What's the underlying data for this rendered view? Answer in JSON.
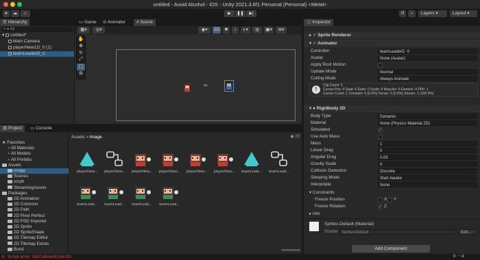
{
  "window": {
    "title": "untitled - Avoid Alcohol - iOS - Unity 2021.3.6f1 Personal (Personal) <Metal>"
  },
  "toolbar": {
    "account_label": "",
    "layers_label": "Layers",
    "layout_label": "Layout"
  },
  "scene_tabs": [
    {
      "label": "Game"
    },
    {
      "label": "Animator"
    },
    {
      "label": "Scene"
    }
  ],
  "scene_toolbar": {
    "mode_2d": "2D"
  },
  "hierarchy": {
    "tab": "Hierarchy",
    "search_placeholder": "All",
    "scene": "untitled*",
    "items": [
      {
        "label": "Main Camera"
      },
      {
        "label": "playerNew1D_0 (1)"
      },
      {
        "label": "teamLeaderD_0"
      }
    ]
  },
  "project": {
    "tabs": [
      {
        "label": "Project"
      },
      {
        "label": "Console"
      }
    ],
    "breadcrumb_root": "Assets",
    "breadcrumb_sep": ">",
    "breadcrumb_leaf": "image",
    "item_count": "23",
    "tree": [
      {
        "label": "Favorites",
        "indent": 0,
        "folder": false,
        "selected": false
      },
      {
        "label": "All Materials",
        "indent": 1,
        "folder": false,
        "selected": false
      },
      {
        "label": "All Models",
        "indent": 1,
        "folder": false,
        "selected": false
      },
      {
        "label": "All Prefabs",
        "indent": 1,
        "folder": false,
        "selected": false
      },
      {
        "label": "Assets",
        "indent": 0,
        "folder": true,
        "selected": false
      },
      {
        "label": "image",
        "indent": 1,
        "folder": true,
        "selected": true
      },
      {
        "label": "Scenes",
        "indent": 1,
        "folder": true,
        "selected": false
      },
      {
        "label": "scrpit",
        "indent": 1,
        "folder": true,
        "selected": false
      },
      {
        "label": "StreamingAssets",
        "indent": 1,
        "folder": true,
        "selected": false
      },
      {
        "label": "Packages",
        "indent": 0,
        "folder": true,
        "selected": false
      },
      {
        "label": "2D Animation",
        "indent": 1,
        "folder": true,
        "selected": false
      },
      {
        "label": "2D Common",
        "indent": 1,
        "folder": true,
        "selected": false
      },
      {
        "label": "2D Path",
        "indent": 1,
        "folder": true,
        "selected": false
      },
      {
        "label": "2D Pixel Perfect",
        "indent": 1,
        "folder": true,
        "selected": false
      },
      {
        "label": "2D PSD Importer",
        "indent": 1,
        "folder": true,
        "selected": false
      },
      {
        "label": "2D Sprite",
        "indent": 1,
        "folder": true,
        "selected": false
      },
      {
        "label": "2D SpriteShape",
        "indent": 1,
        "folder": true,
        "selected": false
      },
      {
        "label": "2D Tilemap Editor",
        "indent": 1,
        "folder": true,
        "selected": false
      },
      {
        "label": "2D Tilemap Extras",
        "indent": 1,
        "folder": true,
        "selected": false
      },
      {
        "label": "Burst",
        "indent": 1,
        "folder": true,
        "selected": false
      }
    ],
    "assets": [
      {
        "label": "playerNew...",
        "kind": "triangle"
      },
      {
        "label": "playerNew...",
        "kind": "controller"
      },
      {
        "label": "playerNew...",
        "kind": "sprite"
      },
      {
        "label": "playerNew...",
        "kind": "sprite"
      },
      {
        "label": "playerNew...",
        "kind": "sprite"
      },
      {
        "label": "playerNew...",
        "kind": "sprite"
      },
      {
        "label": "teamLead...",
        "kind": "triangle"
      },
      {
        "label": "teamLead...",
        "kind": "controller"
      },
      {
        "label": "teamLead...",
        "kind": "sprite-dark"
      },
      {
        "label": "teamLead...",
        "kind": "sprite-dark"
      },
      {
        "label": "teamLead...",
        "kind": "sprite-dark"
      },
      {
        "label": "teamLead...",
        "kind": "sprite-dark"
      }
    ]
  },
  "inspector": {
    "tab": "Inspector",
    "sprite_renderer": "Sprite Renderer",
    "animator": {
      "header": "Animator",
      "rows": [
        {
          "label": "Controller",
          "value": "teamLeaderD_0",
          "type": "field"
        },
        {
          "label": "Avatar",
          "value": "None (Avatar)",
          "type": "field"
        },
        {
          "label": "Apply Root Motion",
          "value": "",
          "type": "check"
        },
        {
          "label": "Update Mode",
          "value": "Normal",
          "type": "field"
        },
        {
          "label": "Culling Mode",
          "value": "Always Animate",
          "type": "field"
        }
      ],
      "info": [
        "Clip Count: 1",
        "Curves Pos: 0 Quat: 0 Euler: 0 Scale: 0 Muscles: 0 Generic: 0 PPtr: 1",
        "Curves Count: 1 Constant: 0 (0.0%) Dense: 0 (0.0%) Stream: 1 (100.0%)"
      ]
    },
    "rigidbody": {
      "header": "Rigidbody 2D",
      "rows": [
        {
          "label": "Body Type",
          "value": "Dynamic",
          "type": "field"
        },
        {
          "label": "Material",
          "value": "None (Physics Material 2D)",
          "type": "field"
        },
        {
          "label": "Simulated",
          "value": "✓",
          "type": "check"
        },
        {
          "label": "Use Auto Mass",
          "value": "",
          "type": "check"
        },
        {
          "label": "Mass",
          "value": "1",
          "type": "field"
        },
        {
          "label": "Linear Drag",
          "value": "0",
          "type": "field"
        },
        {
          "label": "Angular Drag",
          "value": "0.05",
          "type": "field"
        },
        {
          "label": "Gravity Scale",
          "value": "0",
          "type": "field"
        },
        {
          "label": "Collision Detection",
          "value": "Discrete",
          "type": "field"
        },
        {
          "label": "Sleeping Mode",
          "value": "Start Awake",
          "type": "field"
        },
        {
          "label": "Interpolate",
          "value": "None",
          "type": "field"
        }
      ],
      "constraints": "Constraints",
      "freeze_position": "Freeze Position",
      "fp_x": "X",
      "fp_y": "Y",
      "freeze_rotation": "Freeze Rotation",
      "fr_z": "Z",
      "info": "Info"
    },
    "material_name": "Sprites-Default (Material)",
    "shader_label": "Shader",
    "shader_value": "Sprites/Default",
    "edit_label": "Edit...",
    "add_component": "Add Component"
  },
  "status": {
    "error": "Script error: OnCollisionEnter2D"
  },
  "colors": {
    "selection": "#2c5d87",
    "teal": "#46c8c8",
    "error": "#e04848"
  }
}
